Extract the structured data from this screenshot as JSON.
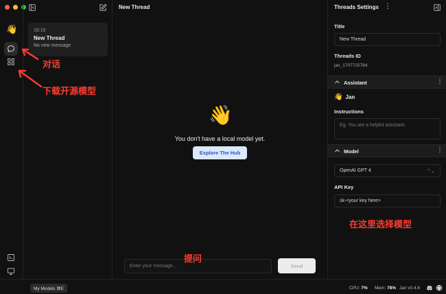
{
  "window": {
    "traffic_lights": [
      "#ff5f57",
      "#febc2e",
      "#28c840"
    ]
  },
  "rail": {
    "logo": "👋",
    "items": [
      {
        "name": "chat",
        "icon": "chat-bubble-icon",
        "active": true
      },
      {
        "name": "hub",
        "icon": "grid-icon",
        "active": false
      }
    ],
    "bottom_items": [
      {
        "name": "local-api",
        "icon": "terminal-icon"
      },
      {
        "name": "system-monitor",
        "icon": "monitor-icon"
      },
      {
        "name": "settings",
        "icon": "gear-icon"
      }
    ]
  },
  "threads": {
    "items": [
      {
        "time": "16:16",
        "title": "New Thread",
        "preview": "No new message"
      }
    ]
  },
  "center": {
    "title": "New Thread",
    "empty_icon": "👋",
    "empty_text": "You don't have a local model yet.",
    "explore_label": "Explore The Hub",
    "input_placeholder": "Enter your message...",
    "send_label": "Send"
  },
  "settings": {
    "header": "Threads Settings",
    "title_label": "Title",
    "title_value": "New Thread",
    "thread_id_label": "Threads ID",
    "thread_id_value": "jan_1707725784",
    "assistant_section": "Assistant",
    "assistant_icon": "👋",
    "assistant_name": "Jan",
    "instructions_label": "Instructions",
    "instructions_placeholder": "Eg. You are a helpful assistant.",
    "model_section": "Model",
    "model_value": "OpenAI GPT 4",
    "api_key_label": "API Key",
    "api_key_value": "sk-<your key here>"
  },
  "status_bar": {
    "my_models_label": "My Models ⌘E",
    "cpu_label": "CPU:",
    "cpu_value": "7%",
    "mem_label": "Mem:",
    "mem_value": "78%",
    "version": "Jan v0.4.6"
  },
  "annotations": {
    "chat": "对话",
    "download": "下载开源模型",
    "ask": "提问",
    "select_model": "在这里选择模型",
    "color": "#ff3b30"
  }
}
